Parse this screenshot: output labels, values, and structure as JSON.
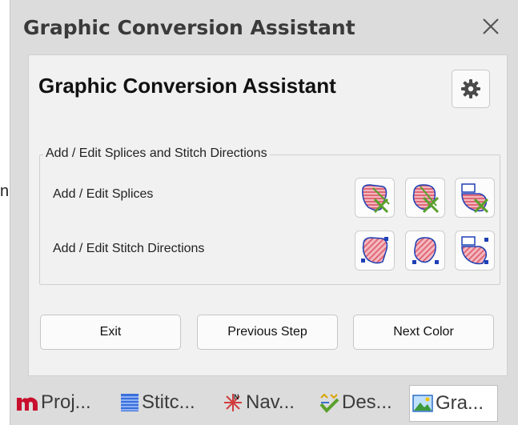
{
  "edge_glyph": "n",
  "window": {
    "title": "Graphic Conversion Assistant"
  },
  "content": {
    "title": "Graphic Conversion Assistant",
    "group_title": "Add / Edit Splices and Stitch Directions",
    "rows": [
      {
        "label": "Add / Edit Splices"
      },
      {
        "label": "Add / Edit Stitch Directions"
      }
    ]
  },
  "buttons": {
    "exit": "Exit",
    "previous": "Previous Step",
    "next": "Next Color"
  },
  "tabs": [
    {
      "icon": "m-logo-icon",
      "label": "Proj..."
    },
    {
      "icon": "stitch-list-icon",
      "label": "Stitc..."
    },
    {
      "icon": "compass-icon",
      "label": "Nav..."
    },
    {
      "icon": "design-check-icon",
      "label": "Des..."
    },
    {
      "icon": "graphic-image-icon",
      "label": "Gra...",
      "active": true
    }
  ],
  "colors": {
    "shape_fill": "#e88c96",
    "shape_stroke": "#1e3fb5",
    "accent_green": "#5aa02c",
    "brand_red": "#c8102e"
  }
}
